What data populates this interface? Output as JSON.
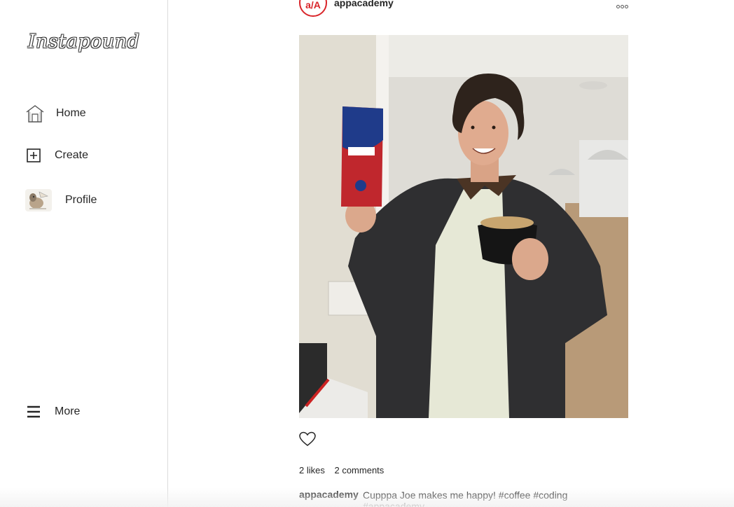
{
  "app": {
    "logo_text": "Instapound"
  },
  "sidebar": {
    "items": [
      {
        "label": "Home",
        "icon": "home-icon"
      },
      {
        "label": "Create",
        "icon": "create-plus-icon"
      },
      {
        "label": "Profile",
        "icon": "profile-avatar"
      },
      {
        "label": "More",
        "icon": "hamburger-menu-icon"
      }
    ]
  },
  "post": {
    "author": "appacademy",
    "author_avatar_text": "a/A",
    "likes": "2 likes",
    "comments": "2 comments",
    "caption_user": "appacademy",
    "caption_text": "Cupppa Joe makes me happy! #coffee #coding #appacademy"
  },
  "colors": {
    "accent": "#d9252a",
    "border": "#dbdbdb",
    "text": "#262626"
  }
}
